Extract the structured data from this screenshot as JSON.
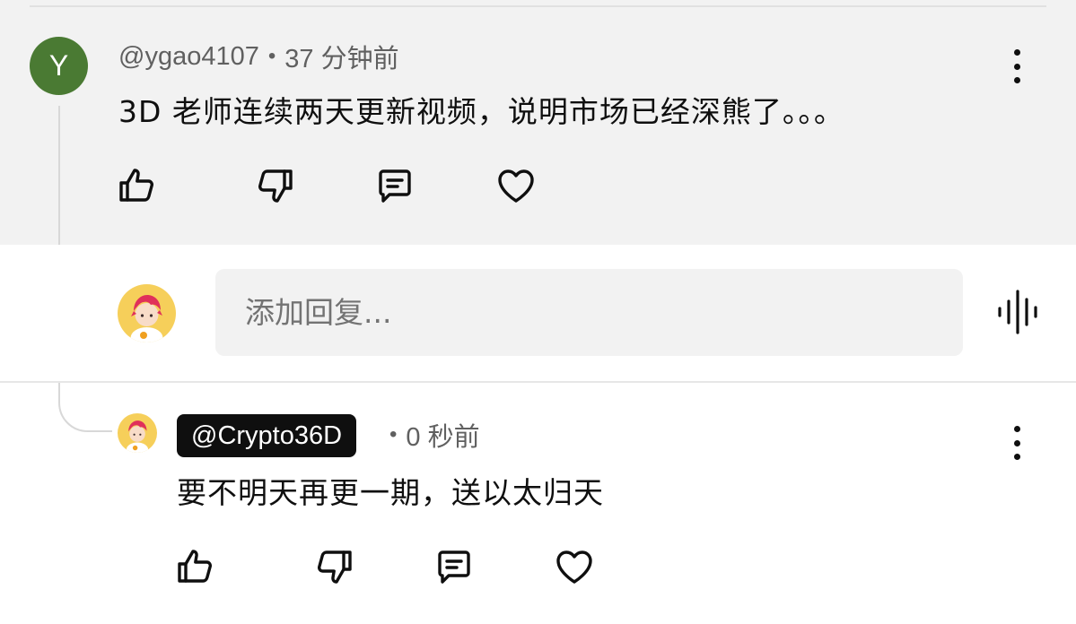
{
  "parent_comment": {
    "avatar_letter": "Y",
    "avatar_color": "#4a7a33",
    "author": "@ygao4107",
    "separator": "•",
    "time": "37 分钟前",
    "text": "3D 老师连续两天更新视频，说明市场已经深熊了。。。",
    "actions": [
      "thumbs-up-icon",
      "thumbs-down-icon",
      "reply-icon",
      "heart-icon"
    ]
  },
  "reply_box": {
    "placeholder": "添加回复...",
    "avatar_icon": "anime-avatar-icon",
    "voice_icon": "voice-input-icon"
  },
  "reply_comment": {
    "author": "@Crypto36D",
    "separator": "•",
    "time": "0 秒前",
    "text": "要不明天再更一期，送以太归天",
    "actions": [
      "thumbs-up-icon",
      "thumbs-down-icon",
      "reply-icon",
      "heart-icon"
    ]
  },
  "colors": {
    "top_background": "#f2f2f2",
    "text_primary": "#0f0f0f",
    "text_secondary": "#606060",
    "handle_badge_bg": "#0f0f0f",
    "avatar_bg": "#f6cf5a"
  }
}
